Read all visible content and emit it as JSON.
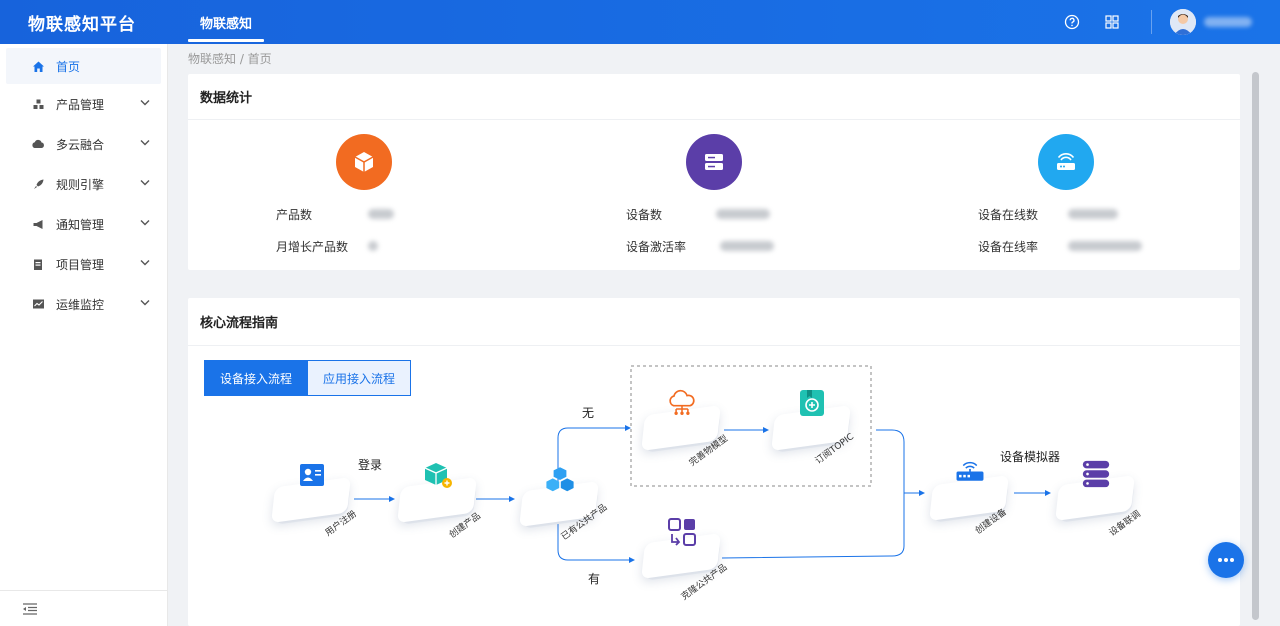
{
  "header": {
    "logo": "物联感知平台",
    "active_tab": "物联感知",
    "help_icon": "question-circle-icon",
    "apps_icon": "grid-icon"
  },
  "sidebar": {
    "items": [
      {
        "label": "首页",
        "icon": "home-icon",
        "active": true
      },
      {
        "label": "产品管理",
        "icon": "cubes-icon"
      },
      {
        "label": "多云融合",
        "icon": "cloud-icon"
      },
      {
        "label": "规则引擎",
        "icon": "rocket-icon"
      },
      {
        "label": "通知管理",
        "icon": "megaphone-icon"
      },
      {
        "label": "项目管理",
        "icon": "clipboard-icon"
      },
      {
        "label": "运维监控",
        "icon": "monitor-icon"
      }
    ],
    "collapse_icon": "menu-fold-icon"
  },
  "breadcrumb": "物联感知 / 首页",
  "stats_card": {
    "title": "数据统计",
    "groups": [
      {
        "icon": "box-icon",
        "color": "#f26b21",
        "label1": "产品数",
        "label2": "月增长产品数"
      },
      {
        "icon": "server-icon",
        "color": "#5b3ea8",
        "label1": "设备数",
        "label2": "设备激活率"
      },
      {
        "icon": "router-icon",
        "color": "#21a8f0",
        "label1": "设备在线数",
        "label2": "设备在线率"
      }
    ]
  },
  "flow_card": {
    "title": "核心流程指南",
    "tabs": [
      "设备接入流程",
      "应用接入流程"
    ],
    "nodes": {
      "register": "用户注册",
      "create_product": "创建产品",
      "public_product": "已有公共产品",
      "thing_model": "完善物模型",
      "topic": "订阅TOPIC",
      "clone": "克隆公共产品",
      "create_device": "创建设备",
      "debug": "设备联调"
    },
    "labels": {
      "login": "登录",
      "none": "无",
      "has": "有",
      "simulator": "设备模拟器"
    }
  },
  "colors": {
    "brand": "#1a73e8",
    "orange": "#f26b21",
    "purple": "#5b3ea8",
    "sky": "#21a8f0",
    "teal": "#1fc1b2"
  }
}
